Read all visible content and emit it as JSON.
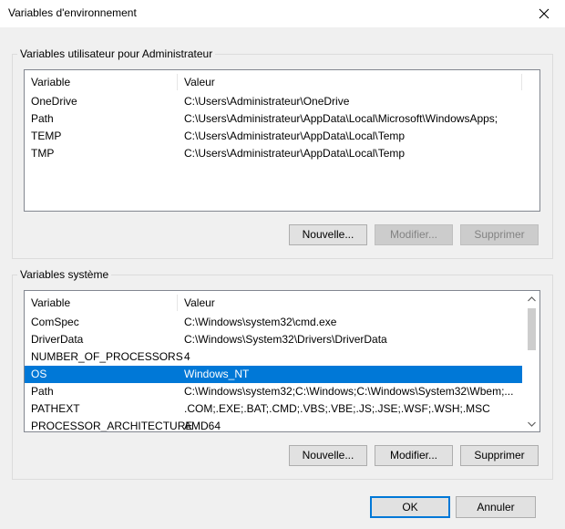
{
  "window": {
    "title": "Variables d'environnement"
  },
  "user_vars": {
    "legend": "Variables utilisateur pour Administrateur",
    "columns": [
      "Variable",
      "Valeur"
    ],
    "rows": [
      {
        "name": "OneDrive",
        "value": "C:\\Users\\Administrateur\\OneDrive"
      },
      {
        "name": "Path",
        "value": "C:\\Users\\Administrateur\\AppData\\Local\\Microsoft\\WindowsApps;"
      },
      {
        "name": "TEMP",
        "value": "C:\\Users\\Administrateur\\AppData\\Local\\Temp"
      },
      {
        "name": "TMP",
        "value": "C:\\Users\\Administrateur\\AppData\\Local\\Temp"
      }
    ],
    "buttons": {
      "new": "Nouvelle...",
      "edit": "Modifier...",
      "delete": "Supprimer"
    }
  },
  "system_vars": {
    "legend": "Variables système",
    "columns": [
      "Variable",
      "Valeur"
    ],
    "rows": [
      {
        "name": "ComSpec",
        "value": "C:\\Windows\\system32\\cmd.exe"
      },
      {
        "name": "DriverData",
        "value": "C:\\Windows\\System32\\Drivers\\DriverData"
      },
      {
        "name": "NUMBER_OF_PROCESSORS",
        "value": "4"
      },
      {
        "name": "OS",
        "value": "Windows_NT",
        "selected": true
      },
      {
        "name": "Path",
        "value": "C:\\Windows\\system32;C:\\Windows;C:\\Windows\\System32\\Wbem;..."
      },
      {
        "name": "PATHEXT",
        "value": ".COM;.EXE;.BAT;.CMD;.VBS;.VBE;.JS;.JSE;.WSF;.WSH;.MSC"
      },
      {
        "name": "PROCESSOR_ARCHITECTURE",
        "value": "AMD64"
      }
    ],
    "buttons": {
      "new": "Nouvelle...",
      "edit": "Modifier...",
      "delete": "Supprimer"
    }
  },
  "dialog_buttons": {
    "ok": "OK",
    "cancel": "Annuler"
  },
  "colors": {
    "selection": "#0078d7",
    "default_button_border": "#0078d7"
  },
  "icons": {
    "close": "close-icon",
    "scroll_up": "chevron-up-icon",
    "scroll_down": "chevron-down-icon"
  }
}
